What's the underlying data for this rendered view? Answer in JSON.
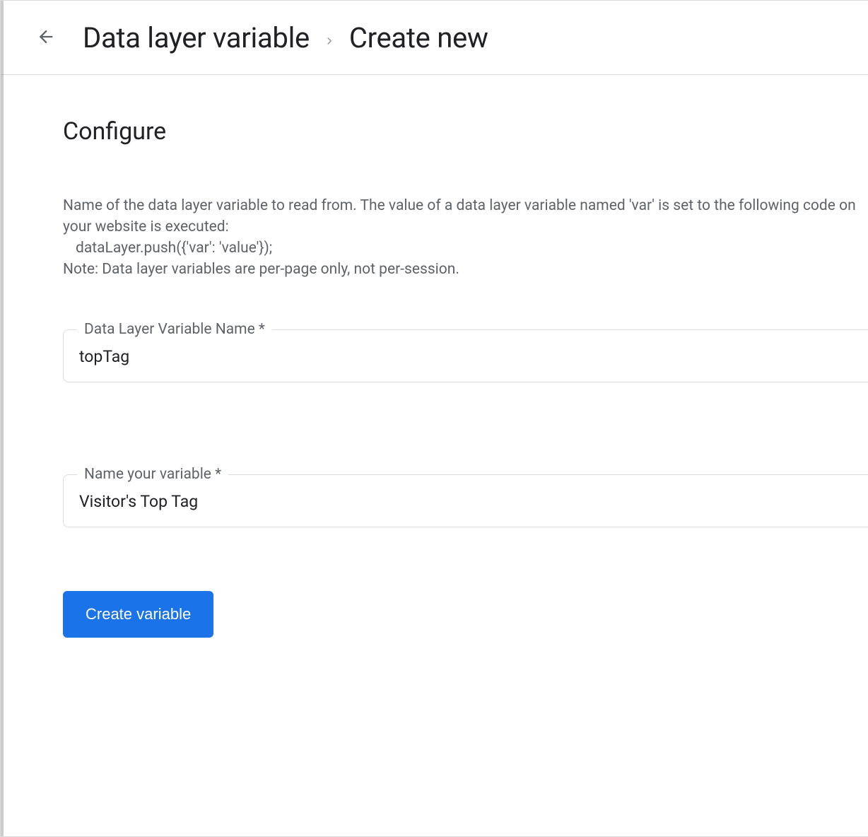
{
  "header": {
    "breadcrumb_a": "Data layer variable",
    "breadcrumb_b": "Create new"
  },
  "main": {
    "section_title": "Configure",
    "help_line1": "Name of the data layer variable to read from. The value of a data layer variable named 'var' is set to the following code on your website is executed:",
    "help_code": "dataLayer.push({'var': 'value'});",
    "help_line3": "Note: Data layer variables are per-page only, not per-session.",
    "fields": {
      "dlv_name": {
        "label": "Data Layer Variable Name *",
        "value": "topTag"
      },
      "var_name": {
        "label": "Name your variable *",
        "value": "Visitor's Top Tag"
      }
    },
    "create_button_label": "Create variable"
  }
}
